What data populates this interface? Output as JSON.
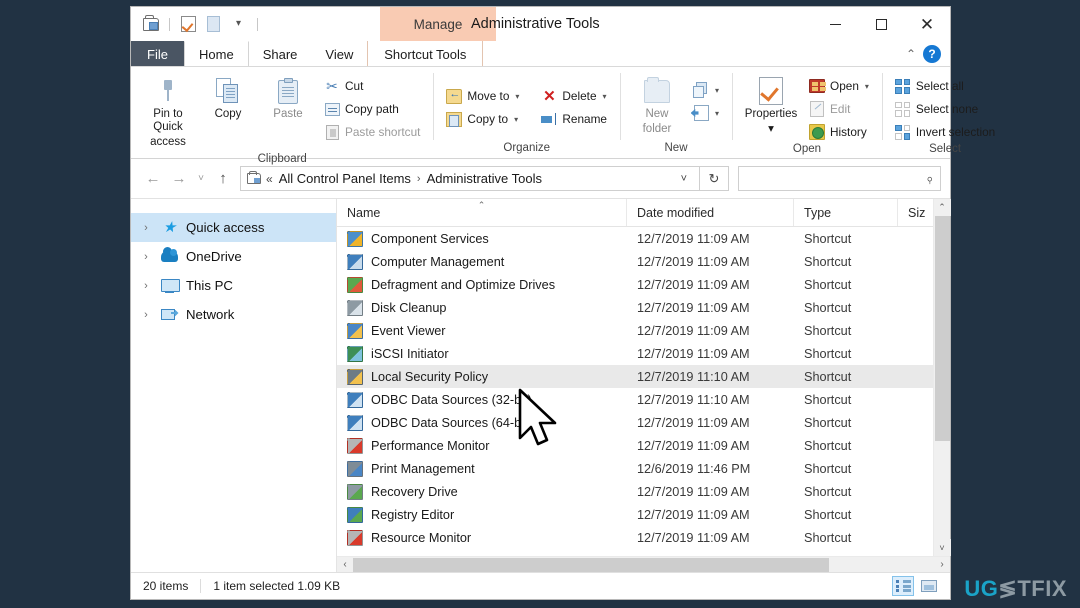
{
  "window": {
    "title": "Administrative Tools",
    "contextual_tab_group": "Manage",
    "minimize_label": "Minimize",
    "maximize_label": "Maximize",
    "close_label": "Close"
  },
  "quick_access_toolbar": {
    "items": [
      {
        "name": "properties-icon",
        "label": "Properties"
      },
      {
        "name": "check-icon",
        "label": "Quick access toolbar item"
      },
      {
        "name": "page-icon",
        "label": "New item"
      },
      {
        "name": "chevron-down-icon",
        "label": "Customize Quick Access Toolbar",
        "glyph": "▾"
      }
    ]
  },
  "tabs": [
    {
      "id": "file",
      "label": "File"
    },
    {
      "id": "home",
      "label": "Home"
    },
    {
      "id": "share",
      "label": "Share"
    },
    {
      "id": "view",
      "label": "View"
    },
    {
      "id": "shortcut-tools",
      "label": "Shortcut Tools"
    }
  ],
  "tabstrip_right": {
    "collapse_ribbon": "⌃",
    "help": "?"
  },
  "ribbon": {
    "groups": [
      {
        "id": "clipboard",
        "label": "Clipboard",
        "big_buttons": [
          {
            "id": "pin-to-quick-access",
            "label_line1": "Pin to Quick",
            "label_line2": "access",
            "icon": "pin-icon"
          },
          {
            "id": "copy",
            "label_line1": "Copy",
            "label_line2": "",
            "icon": "copy-icon"
          },
          {
            "id": "paste",
            "label_line1": "Paste",
            "label_line2": "",
            "icon": "paste-icon",
            "dim": true
          }
        ],
        "small_buttons": [
          {
            "id": "cut",
            "label": "Cut",
            "icon": "scissors-icon",
            "dim": false
          },
          {
            "id": "copy-path",
            "label": "Copy path",
            "icon": "copy-path-icon",
            "dim": false
          },
          {
            "id": "paste-shortcut",
            "label": "Paste shortcut",
            "icon": "paste-shortcut-icon",
            "dim": true
          }
        ]
      },
      {
        "id": "organize",
        "label": "Organize",
        "small_buttons": [
          {
            "id": "move-to",
            "label": "Move to",
            "icon": "move-to-icon",
            "dropdown": true
          },
          {
            "id": "copy-to",
            "label": "Copy to",
            "icon": "copy-to-icon",
            "dropdown": true
          },
          {
            "id": "delete",
            "label": "Delete",
            "icon": "delete-icon",
            "dropdown": true
          },
          {
            "id": "rename",
            "label": "Rename",
            "icon": "rename-icon",
            "dropdown": false
          }
        ]
      },
      {
        "id": "new",
        "label": "New",
        "big_buttons": [
          {
            "id": "new-folder",
            "label_line1": "New",
            "label_line2": "folder",
            "icon": "new-folder-icon",
            "dim": true
          }
        ],
        "small_buttons": [
          {
            "id": "new-item",
            "label": "",
            "icon": "new-item-icon",
            "dropdown": true
          },
          {
            "id": "easy-access",
            "label": "",
            "icon": "easy-access-icon",
            "dropdown": true
          }
        ]
      },
      {
        "id": "open",
        "label": "Open",
        "big_buttons": [
          {
            "id": "properties",
            "label_line1": "Properties",
            "label_line2": "▾",
            "icon": "properties-icon"
          }
        ],
        "small_buttons": [
          {
            "id": "open",
            "label": "Open",
            "icon": "open-icon",
            "dropdown": true
          },
          {
            "id": "edit",
            "label": "Edit",
            "icon": "edit-icon",
            "dim": true
          },
          {
            "id": "history",
            "label": "History",
            "icon": "history-icon"
          }
        ]
      },
      {
        "id": "select",
        "label": "Select",
        "small_buttons": [
          {
            "id": "select-all",
            "label": "Select all",
            "icon": "select-all-icon"
          },
          {
            "id": "select-none",
            "label": "Select none",
            "icon": "select-none-icon"
          },
          {
            "id": "invert-selection",
            "label": "Invert selection",
            "icon": "invert-selection-icon"
          }
        ]
      }
    ]
  },
  "addressbar": {
    "back": "←",
    "forward": "→",
    "recent": "˅",
    "up": "↑",
    "crumb_separator_first": "«",
    "crumbs": [
      "All Control Panel Items",
      "Administrative Tools"
    ],
    "crumb_separator": "›",
    "dropdown": "˅",
    "refresh": "↻",
    "search_placeholder": "",
    "search_value": "",
    "search_icon": "⌕"
  },
  "navpane": {
    "items": [
      {
        "id": "quick-access",
        "label": "Quick access",
        "icon": "star-icon",
        "selected": true
      },
      {
        "id": "onedrive",
        "label": "OneDrive",
        "icon": "cloud-icon",
        "selected": false
      },
      {
        "id": "this-pc",
        "label": "This PC",
        "icon": "monitor-icon",
        "selected": false
      },
      {
        "id": "network",
        "label": "Network",
        "icon": "network-icon",
        "selected": false
      }
    ],
    "expander": "›"
  },
  "filelist": {
    "columns": [
      {
        "id": "name",
        "label": "Name",
        "sorted": true,
        "sort_glyph": "⌃"
      },
      {
        "id": "date",
        "label": "Date modified"
      },
      {
        "id": "type",
        "label": "Type"
      },
      {
        "id": "size",
        "label": "Siz"
      }
    ],
    "rows": [
      {
        "name": "Component Services",
        "date": "12/7/2019 11:09 AM",
        "type": "Shortcut",
        "selected": false,
        "icon_color": "#4d8fc9",
        "icon_accent": "#f0b429"
      },
      {
        "name": "Computer Management",
        "date": "12/7/2019 11:09 AM",
        "type": "Shortcut",
        "selected": false,
        "icon_color": "#3f7fbd",
        "icon_accent": "#c9dcec"
      },
      {
        "name": "Defragment and Optimize Drives",
        "date": "12/7/2019 11:09 AM",
        "type": "Shortcut",
        "selected": false,
        "icon_color": "#5aa84f",
        "icon_accent": "#e05a3c"
      },
      {
        "name": "Disk Cleanup",
        "date": "12/7/2019 11:09 AM",
        "type": "Shortcut",
        "selected": false,
        "icon_color": "#8d9aa3",
        "icon_accent": "#d9e2e9"
      },
      {
        "name": "Event Viewer",
        "date": "12/7/2019 11:09 AM",
        "type": "Shortcut",
        "selected": false,
        "icon_color": "#4a86c5",
        "icon_accent": "#f2c14e"
      },
      {
        "name": "iSCSI Initiator",
        "date": "12/7/2019 11:09 AM",
        "type": "Shortcut",
        "selected": false,
        "icon_color": "#3d8f55",
        "icon_accent": "#7fc3dd"
      },
      {
        "name": "Local Security Policy",
        "date": "12/7/2019 11:10 AM",
        "type": "Shortcut",
        "selected": true,
        "icon_color": "#6d7b86",
        "icon_accent": "#f2c14e"
      },
      {
        "name": "ODBC Data Sources (32-bit)",
        "date": "12/7/2019 11:10 AM",
        "type": "Shortcut",
        "selected": false,
        "icon_color": "#3f7fbd",
        "icon_accent": "#cfe2f2"
      },
      {
        "name": "ODBC Data Sources (64-bit)",
        "date": "12/7/2019 11:09 AM",
        "type": "Shortcut",
        "selected": false,
        "icon_color": "#3f7fbd",
        "icon_accent": "#cfe2f2"
      },
      {
        "name": "Performance Monitor",
        "date": "12/7/2019 11:09 AM",
        "type": "Shortcut",
        "selected": false,
        "icon_color": "#b5b5b5",
        "icon_accent": "#d93a2b"
      },
      {
        "name": "Print Management",
        "date": "12/6/2019 11:46 PM",
        "type": "Shortcut",
        "selected": false,
        "icon_color": "#7f8c96",
        "icon_accent": "#4a86c5"
      },
      {
        "name": "Recovery Drive",
        "date": "12/7/2019 11:09 AM",
        "type": "Shortcut",
        "selected": false,
        "icon_color": "#8d9aa3",
        "icon_accent": "#5aa84f"
      },
      {
        "name": "Registry Editor",
        "date": "12/7/2019 11:09 AM",
        "type": "Shortcut",
        "selected": false,
        "icon_color": "#3f7fbd",
        "icon_accent": "#5aa84f"
      },
      {
        "name": "Resource Monitor",
        "date": "12/7/2019 11:09 AM",
        "type": "Shortcut",
        "selected": false,
        "icon_color": "#b5b5b5",
        "icon_accent": "#d93a2b"
      }
    ]
  },
  "scrollbars": {
    "vertical": {
      "up": "⌃",
      "down": "˅"
    },
    "horizontal": {
      "left": "‹",
      "right": "›"
    }
  },
  "statusbar": {
    "item_count": "20 items",
    "selection": "1 item selected  1.09 KB",
    "view_buttons": [
      {
        "id": "details-view",
        "label": "Details view",
        "active": true
      },
      {
        "id": "large-icons-view",
        "label": "Large icons view",
        "active": false
      }
    ]
  },
  "watermark": {
    "part1": "UG",
    "part2": "≶",
    "part3": "TFIX"
  }
}
